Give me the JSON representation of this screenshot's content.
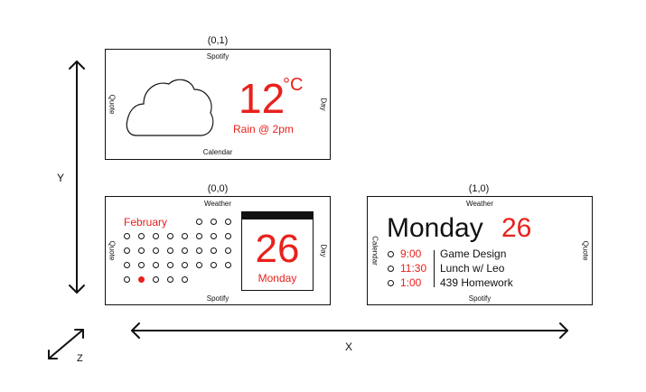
{
  "axes": {
    "x_label": "X",
    "y_label": "Y",
    "z_label": "Z"
  },
  "colors": {
    "accent": "#e8211c",
    "ink": "#111111"
  },
  "panels": {
    "top": {
      "coord": "(0,1)",
      "edge_top": "Spotify",
      "edge_bottom": "Calendar",
      "edge_left": "Quote",
      "edge_right": "Day",
      "weather_icon": "cloud-icon",
      "temp_value": "12",
      "temp_unit": "°C",
      "forecast": "Rain @ 2pm"
    },
    "middle": {
      "coord": "(0,0)",
      "edge_top": "Weather",
      "edge_bottom": "Spotify",
      "edge_left": "Quote",
      "edge_right": "Day",
      "month": "February",
      "day_number": "26",
      "day_name": "Monday"
    },
    "right": {
      "coord": "(1,0)",
      "edge_top": "Weather",
      "edge_bottom": "Spotify",
      "edge_left": "Calendar",
      "edge_right": "Quote",
      "day_name": "Monday",
      "day_number": "26",
      "events": [
        {
          "time": "9:00",
          "title": "Game Design"
        },
        {
          "time": "11:30",
          "title": "Lunch w/ Leo"
        },
        {
          "time": "1:00",
          "title": "439 Homework"
        }
      ]
    }
  }
}
